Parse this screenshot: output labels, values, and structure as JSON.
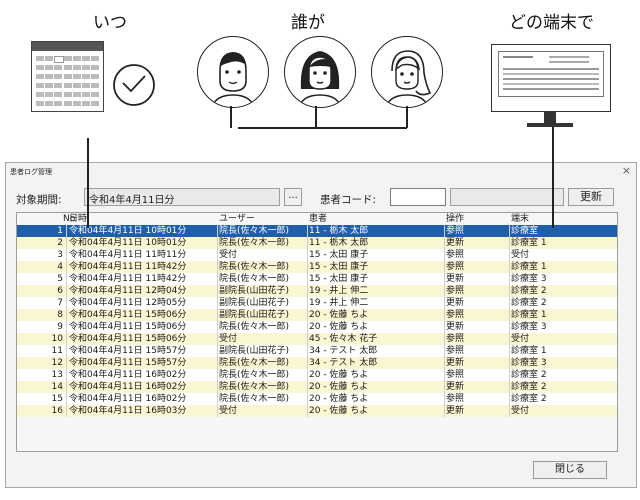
{
  "headers": {
    "when": "いつ",
    "who": "誰が",
    "which_terminal": "どの端末で"
  },
  "dialog": {
    "title": "患者ログ管理",
    "close_symbol": "×",
    "period_label": "対象期間:",
    "period_value": "令和4年4月11日分",
    "ellipsis_button": "...",
    "patient_code_label": "患者コード:",
    "patient_code_value": "",
    "patient_name_value": "",
    "refresh_button": "更新",
    "close_button": "閉じる"
  },
  "table": {
    "columns": [
      "No",
      "日時",
      "ユーザー",
      "患者",
      "操作",
      "端末"
    ],
    "rows": [
      {
        "no": "1",
        "datetime": "令和04年4月11日 10時01分",
        "user": "院長(佐々木一郎)",
        "patient": "11 - 栃木 太郎",
        "op": "参照",
        "terminal": "診療室"
      },
      {
        "no": "2",
        "datetime": "令和04年4月11日 10時01分",
        "user": "院長(佐々木一郎)",
        "patient": "11 - 栃木 太郎",
        "op": "更新",
        "terminal": "診療室 1"
      },
      {
        "no": "3",
        "datetime": "令和04年4月11日 11時11分",
        "user": "受付",
        "patient": "15 - 太田 康子",
        "op": "参照",
        "terminal": "受付"
      },
      {
        "no": "4",
        "datetime": "令和04年4月11日 11時42分",
        "user": "院長(佐々木一郎)",
        "patient": "15 - 太田 康子",
        "op": "参照",
        "terminal": "診療室 1"
      },
      {
        "no": "5",
        "datetime": "令和04年4月11日 11時42分",
        "user": "院長(佐々木一郎)",
        "patient": "15 - 太田 康子",
        "op": "更新",
        "terminal": "診療室 3"
      },
      {
        "no": "6",
        "datetime": "令和04年4月11日 12時04分",
        "user": "副院長(山田花子)",
        "patient": "19 - 井上 伸二",
        "op": "参照",
        "terminal": "診療室 2"
      },
      {
        "no": "7",
        "datetime": "令和04年4月11日 12時05分",
        "user": "副院長(山田花子)",
        "patient": "19 - 井上 伸二",
        "op": "更新",
        "terminal": "診療室 2"
      },
      {
        "no": "8",
        "datetime": "令和04年4月11日 15時06分",
        "user": "副院長(山田花子)",
        "patient": "20 - 佐藤 ちよ",
        "op": "参照",
        "terminal": "診療室 1"
      },
      {
        "no": "9",
        "datetime": "令和04年4月11日 15時06分",
        "user": "院長(佐々木一郎)",
        "patient": "20 - 佐藤 ちよ",
        "op": "更新",
        "terminal": "診療室 3"
      },
      {
        "no": "10",
        "datetime": "令和04年4月11日 15時06分",
        "user": "受付",
        "patient": "45 - 佐々木 花子",
        "op": "参照",
        "terminal": "受付"
      },
      {
        "no": "11",
        "datetime": "令和04年4月11日 15時57分",
        "user": "副院長(山田花子)",
        "patient": "34 - テスト 太郎",
        "op": "参照",
        "terminal": "診療室 1"
      },
      {
        "no": "12",
        "datetime": "令和04年4月11日 15時57分",
        "user": "院長(佐々木一郎)",
        "patient": "34 - テスト 太郎",
        "op": "更新",
        "terminal": "診療室 3"
      },
      {
        "no": "13",
        "datetime": "令和04年4月11日 16時02分",
        "user": "院長(佐々木一郎)",
        "patient": "20 - 佐藤 ちよ",
        "op": "参照",
        "terminal": "診療室 2"
      },
      {
        "no": "14",
        "datetime": "令和04年4月11日 16時02分",
        "user": "院長(佐々木一郎)",
        "patient": "20 - 佐藤 ちよ",
        "op": "更新",
        "terminal": "診療室 2"
      },
      {
        "no": "15",
        "datetime": "令和04年4月11日 16時02分",
        "user": "院長(佐々木一郎)",
        "patient": "20 - 佐藤 ちよ",
        "op": "参照",
        "terminal": "診療室 2"
      },
      {
        "no": "16",
        "datetime": "令和04年4月11日 16時03分",
        "user": "受付",
        "patient": "20 - 佐藤 ちよ",
        "op": "更新",
        "terminal": "受付"
      }
    ]
  },
  "icons": {
    "calendar": "calendar-icon",
    "clock": "clock-icon",
    "person_male": "man-icon",
    "person_female": "woman-icon",
    "person_long_hair": "woman-long-hair-icon",
    "monitor": "monitor-icon"
  },
  "colors": {
    "selected_row": "#1f5ea8",
    "even_row": "#fbf6d2",
    "odd_row": "#ffffff"
  }
}
